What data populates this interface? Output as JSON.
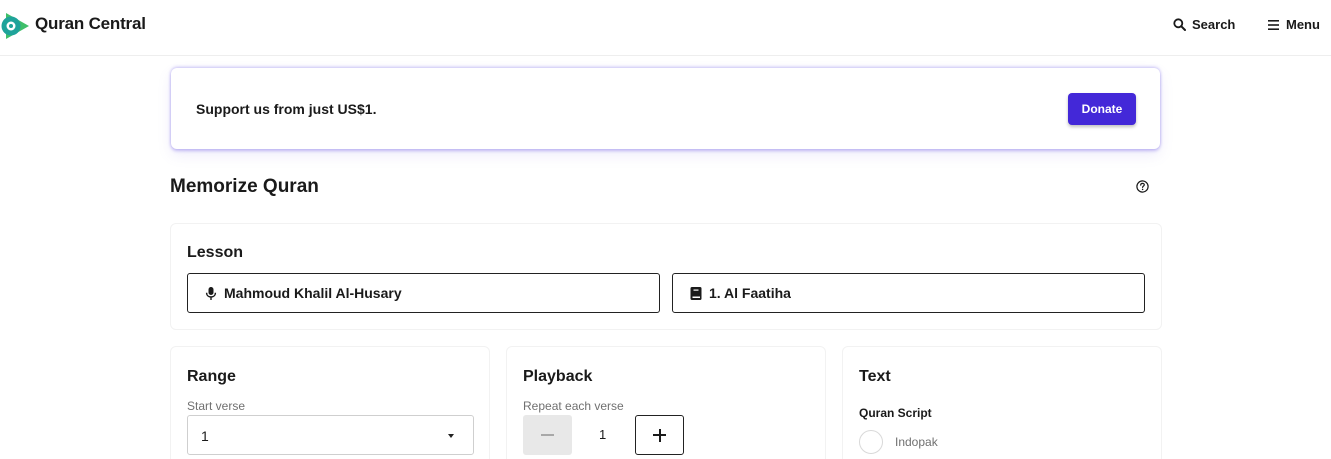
{
  "header": {
    "brand": "Quran Central",
    "search_label": "Search",
    "menu_label": "Menu"
  },
  "donate_banner": {
    "text": "Support us from just US$1.",
    "button_label": "Donate"
  },
  "page": {
    "title": "Memorize Quran"
  },
  "lesson": {
    "title": "Lesson",
    "reciter": "Mahmoud Khalil Al-Husary",
    "surah": "1. Al Faatiha"
  },
  "range": {
    "title": "Range",
    "start_verse_label": "Start verse",
    "start_verse_value": "1"
  },
  "playback": {
    "title": "Playback",
    "repeat_label": "Repeat each verse",
    "repeat_value": "1"
  },
  "text_settings": {
    "title": "Text",
    "script_label": "Quran Script",
    "script_options": [
      "Indopak"
    ]
  },
  "colors": {
    "accent": "#4328d8",
    "logo_green": "#3fbf6a",
    "logo_teal": "#1fa39a"
  },
  "icons": {
    "search": "search-icon",
    "menu": "hamburger-menu-icon",
    "help": "help-circle-icon",
    "reciter": "microphone-icon",
    "surah": "book-icon",
    "dropdown": "caret-down-icon"
  }
}
